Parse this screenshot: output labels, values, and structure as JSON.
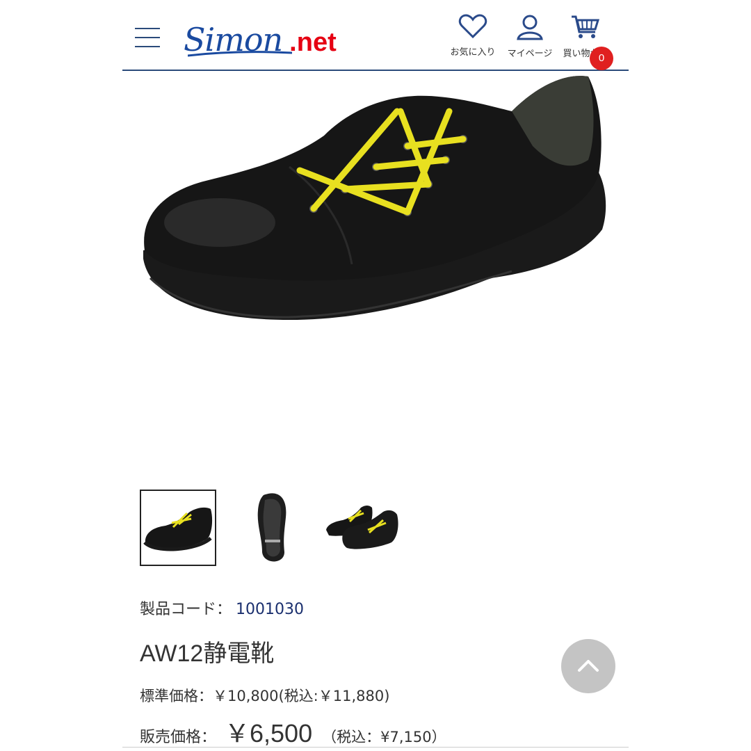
{
  "header": {
    "favorites_label": "お気に入り",
    "mypage_label": "マイページ",
    "cart_label": "買い物かご",
    "cart_count": "0"
  },
  "logo": {
    "brand": "Simon",
    "suffix": ".net"
  },
  "product": {
    "code_label": "製品コード：",
    "code_value": "1001030",
    "title": "AW12静電靴",
    "standard_price_text": "標準価格：￥10,800(税込:￥11,880)",
    "sale_label": "販売価格：",
    "sale_price": "￥6,500",
    "sale_tax_text": "（税込：¥7,150）"
  },
  "colors": {
    "brand_blue": "#1a4aa0",
    "brand_red": "#e60012",
    "header_line": "#2a4a7a",
    "lace_yellow": "#e8e020"
  },
  "icons": [
    "menu-icon",
    "heart-icon",
    "user-icon",
    "cart-icon",
    "chevron-up-icon"
  ]
}
